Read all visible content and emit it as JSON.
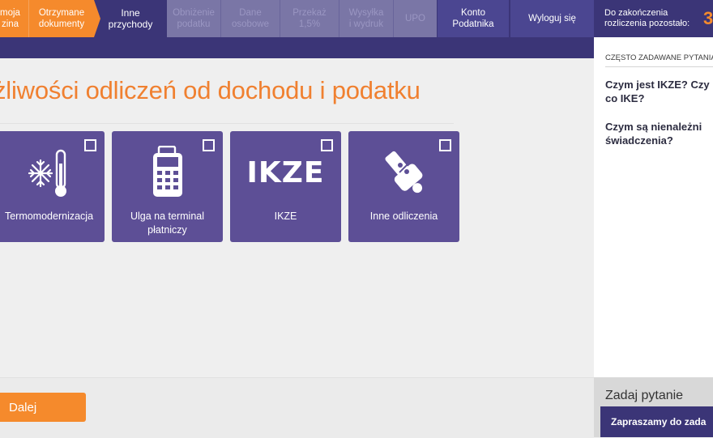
{
  "nav": {
    "steps": [
      {
        "line1": "moja",
        "line2": "zina"
      },
      {
        "line1": "Otrzymane",
        "line2": "dokumenty"
      },
      {
        "line1": "Inne",
        "line2": "przychody"
      },
      {
        "line1": "Obniżenie",
        "line2": "podatku"
      },
      {
        "line1": "Dane",
        "line2": "osobowe"
      },
      {
        "line1": "Przekaż",
        "line2": "1,5%"
      },
      {
        "line1": "Wysyłka",
        "line2": "i wydruk"
      },
      {
        "line1": "UPO",
        "line2": ""
      }
    ],
    "account": {
      "line1": "Konto",
      "line2": "Podatnika"
    },
    "logout": "Wyloguj się",
    "countdown_label_1": "Do zakończenia",
    "countdown_label_2": "rozliczenia pozostało:",
    "countdown_value": "3"
  },
  "main": {
    "title": "żliwości odliczeń od dochodu i podatku",
    "cards": [
      {
        "label_1": "Termomodernizacja",
        "label_2": "",
        "icon": "thermometer-snowflake-icon"
      },
      {
        "label_1": "Ulga na terminal",
        "label_2": "płatniczy",
        "icon": "payment-terminal-icon"
      },
      {
        "label_1": "IKZE",
        "label_2": "",
        "icon_text": "IKZE",
        "icon": "ikze-logo-icon"
      },
      {
        "label_1": "Inne odliczenia",
        "label_2": "",
        "icon": "hand-percent-icon"
      }
    ],
    "next_button": "Dalej"
  },
  "sidebar": {
    "faq_header": "CZĘSTO ZADAWANE PYTANIA",
    "faq": [
      {
        "line1": "Czym jest IKZE? Czy",
        "line2": "co IKE?"
      },
      {
        "line1": "Czym są nienależni",
        "line2": "świadczenia?"
      }
    ],
    "ask_title": "Zadaj pytanie",
    "ask_button": "Zapraszamy do zada"
  },
  "colors": {
    "nav": "#3b3577",
    "orange": "#f58a2c",
    "card": "#5d4f96"
  }
}
